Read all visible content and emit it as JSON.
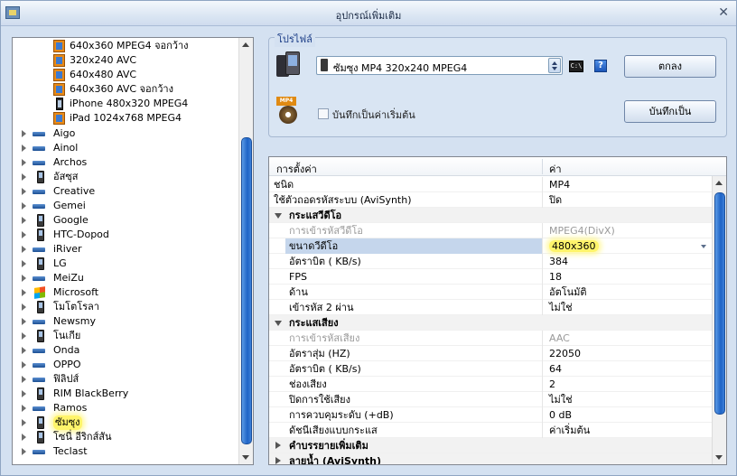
{
  "window": {
    "title": "อุปกรณ์เพิ่มเติม"
  },
  "tree": {
    "children": [
      {
        "label": "640x360 MPEG4  จอกว้าง",
        "icon": "video-icon"
      },
      {
        "label": "320x240 AVC",
        "icon": "video-icon"
      },
      {
        "label": "640x480 AVC",
        "icon": "video-icon"
      },
      {
        "label": "640x360 AVC  จอกว้าง",
        "icon": "video-icon"
      },
      {
        "label": "iPhone 480x320 MPEG4",
        "icon": "iphone-icon"
      },
      {
        "label": "iPad 1024x768 MPEG4",
        "icon": "ipad-icon"
      }
    ],
    "brands": [
      {
        "label": "Aigo",
        "icon": "device-icon"
      },
      {
        "label": "Ainol",
        "icon": "device-icon"
      },
      {
        "label": "Archos",
        "icon": "device-icon"
      },
      {
        "label": "อัสซุส",
        "icon": "phone-icon"
      },
      {
        "label": "Creative",
        "icon": "device-icon"
      },
      {
        "label": "Gemei",
        "icon": "device-icon"
      },
      {
        "label": "Google",
        "icon": "phone-icon"
      },
      {
        "label": "HTC-Dopod",
        "icon": "phone-icon"
      },
      {
        "label": "iRiver",
        "icon": "device-icon"
      },
      {
        "label": "LG",
        "icon": "phone-icon"
      },
      {
        "label": "MeiZu",
        "icon": "device-icon"
      },
      {
        "label": "Microsoft",
        "icon": "windows-icon"
      },
      {
        "label": "โมโตโรลา",
        "icon": "phone-icon"
      },
      {
        "label": "Newsmy",
        "icon": "device-icon"
      },
      {
        "label": "โนเกีย",
        "icon": "phone-icon"
      },
      {
        "label": "Onda",
        "icon": "device-icon"
      },
      {
        "label": "OPPO",
        "icon": "device-icon"
      },
      {
        "label": "ฟิลิปส์",
        "icon": "device-icon"
      },
      {
        "label": "RIM BlackBerry",
        "icon": "phone-icon"
      },
      {
        "label": "Ramos",
        "icon": "device-icon"
      },
      {
        "label": "ซัมซุง",
        "icon": "phone-icon",
        "highlighted": true
      },
      {
        "label": "โซนี่ อีริกส์สัน",
        "icon": "phone-icon"
      },
      {
        "label": "Teclast",
        "icon": "device-icon"
      }
    ]
  },
  "profile": {
    "legend": "โปรไฟล์",
    "selected": "ซัมซุง MP4 320x240 MPEG4",
    "ok_label": "ตกลง",
    "save_default_label": "บันทึกเป็นค่าเริ่มต้น",
    "save_as_label": "บันทึกเป็น",
    "tag_label": "MP4",
    "cmd_label": "C:\\",
    "help_label": "?"
  },
  "grid": {
    "header_setting": "การตั้งค่า",
    "header_value": "ค่า",
    "rows": [
      {
        "name": "ชนิด",
        "value": "MP4",
        "kind": "plain"
      },
      {
        "name": "ใช้ตัวถอดรหัสระบบ (AviSynth)",
        "value": "ปิด",
        "kind": "plain"
      },
      {
        "name": "กระแสวีดีโอ",
        "value": "",
        "kind": "section-open"
      },
      {
        "name": "การเข้ารหัสวีดีโอ",
        "value": "MPEG4(DivX)",
        "kind": "disabled"
      },
      {
        "name": "ขนาดวีดีโอ",
        "value": "480x360",
        "kind": "selected"
      },
      {
        "name": "อัตราบิต ( KB/s)",
        "value": "384",
        "kind": "indent"
      },
      {
        "name": "FPS",
        "value": "18",
        "kind": "indent"
      },
      {
        "name": "ด้าน",
        "value": "อัตโนมัติ",
        "kind": "indent"
      },
      {
        "name": "เข้ารหัส 2 ผ่าน",
        "value": "ไม่ใช่",
        "kind": "indent"
      },
      {
        "name": "กระแสเสียง",
        "value": "",
        "kind": "section-open"
      },
      {
        "name": "การเข้ารหัสเสียง",
        "value": "AAC",
        "kind": "disabled"
      },
      {
        "name": "อัตราสุ่ม (HZ)",
        "value": "22050",
        "kind": "indent"
      },
      {
        "name": "อัตราบิต ( KB/s)",
        "value": "64",
        "kind": "indent"
      },
      {
        "name": "ช่องเสียง",
        "value": "2",
        "kind": "indent"
      },
      {
        "name": "ปิดการใช้เสียง",
        "value": "ไม่ใช่",
        "kind": "indent"
      },
      {
        "name": "การควบคุมระดับ (+dB)",
        "value": "0 dB",
        "kind": "indent"
      },
      {
        "name": "ดัชนีเสียงแบบกระแส",
        "value": "ค่าเริ่มต้น",
        "kind": "indent"
      },
      {
        "name": "คำบรรยายเพิ่มเติม",
        "value": "",
        "kind": "section-closed"
      },
      {
        "name": "ลายน้ำ (AviSynth)",
        "value": "",
        "kind": "section-closed"
      }
    ]
  }
}
